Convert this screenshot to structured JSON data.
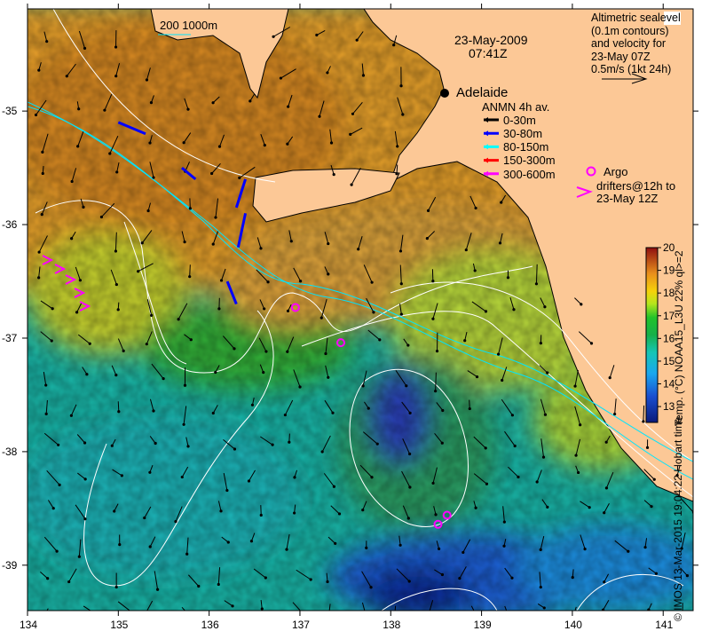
{
  "map": {
    "date": "23-May-2009",
    "time": "07:41Z",
    "scale_label": "200  1000m",
    "place": "Adelaide",
    "place_lonlat": [
      138.6,
      -34.93
    ],
    "altimetry_note": [
      "Altimetric sealevel",
      "(0.1m contours)",
      "and velocity for",
      "23-May 07Z",
      "0.5m/s (1kt 24h)"
    ],
    "legend": {
      "title": "ANMN 4h av.",
      "items": [
        {
          "label": "0-30m",
          "color": "#000000"
        },
        {
          "label": "30-80m",
          "color": "#0000ff"
        },
        {
          "label": "80-150m",
          "color": "#00ffff"
        },
        {
          "label": "150-300m",
          "color": "#ff0000"
        },
        {
          "label": "300-600m",
          "color": "#ff00ff"
        }
      ]
    },
    "argo_label": "Argo",
    "drifter_label": [
      "drifters@12h to",
      "23-May 12Z"
    ],
    "argo_positions": [
      [
        136.95,
        -36.73
      ],
      [
        137.45,
        -37.04
      ],
      [
        138.52,
        -38.64
      ],
      [
        138.62,
        -38.56
      ]
    ],
    "lon_ticks": [
      "134",
      "135",
      "136",
      "137",
      "138",
      "139",
      "140",
      "141"
    ],
    "lat_ticks": [
      "-35",
      "-36",
      "-37",
      "-38",
      "-39"
    ],
    "lon_range": [
      134,
      141.33
    ],
    "lat_range": [
      -34.1,
      -39.4
    ],
    "colorbar": {
      "title": "Temp. (°C) NOAA15_L3U 22% ql>=2",
      "ticks": [
        "20",
        "19",
        "18",
        "17",
        "16",
        "15",
        "14",
        "13"
      ],
      "range": [
        12.3,
        20
      ]
    },
    "credit": "© IMOS 13-Mar-2015 19:04:22 Hobart time",
    "colors": {
      "land": "#fcc896",
      "accent_argo": "#ff00ff"
    }
  }
}
